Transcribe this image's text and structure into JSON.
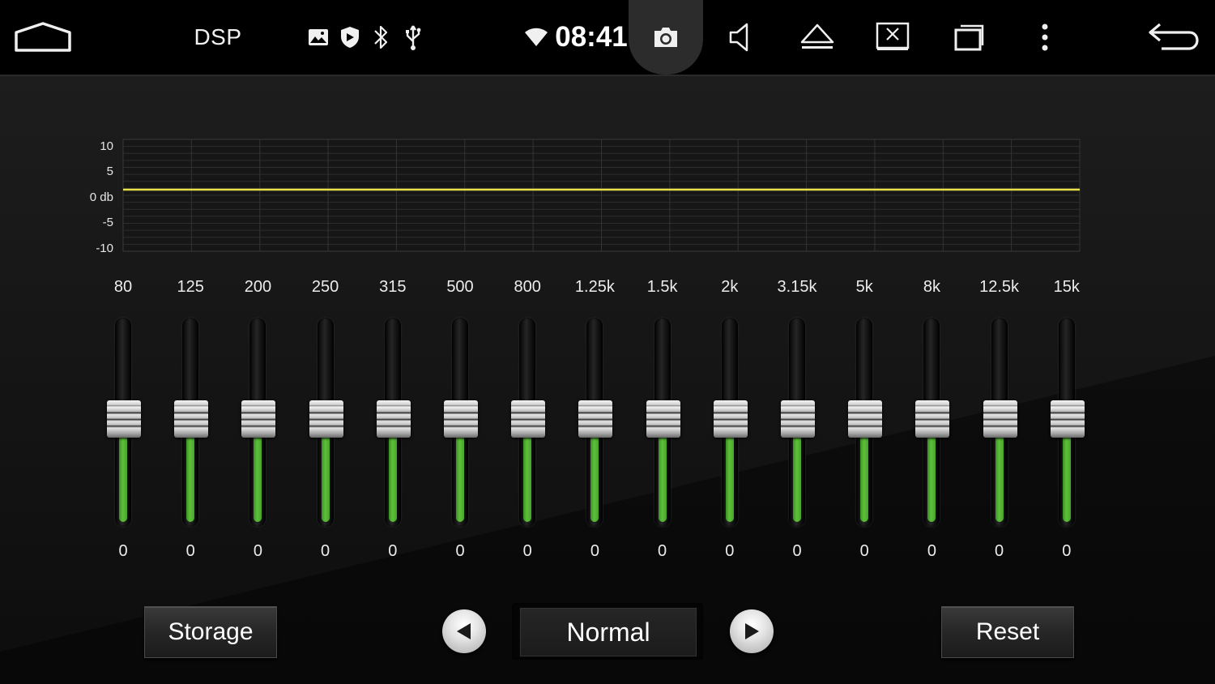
{
  "status_bar": {
    "app_title": "DSP",
    "clock": "08:41",
    "icons": {
      "home": "home-icon",
      "gallery": "image-icon",
      "shield": "shield-icon",
      "bluetooth": "bluetooth-icon",
      "usb": "usb-icon",
      "wifi": "wifi-icon",
      "screenshot": "camera-icon",
      "volume": "volume-icon",
      "eject": "eject-icon",
      "screen_off": "screen-off-icon",
      "recents": "recents-icon",
      "menu": "more-vert-icon",
      "back": "back-icon"
    }
  },
  "curve": {
    "y_labels": [
      "10",
      "5",
      "0 db",
      "-5",
      "-10"
    ],
    "line_color": "#e8e04a"
  },
  "bands": [
    {
      "freq": "80",
      "value": "0",
      "level": 0
    },
    {
      "freq": "125",
      "value": "0",
      "level": 0
    },
    {
      "freq": "200",
      "value": "0",
      "level": 0
    },
    {
      "freq": "250",
      "value": "0",
      "level": 0
    },
    {
      "freq": "315",
      "value": "0",
      "level": 0
    },
    {
      "freq": "500",
      "value": "0",
      "level": 0
    },
    {
      "freq": "800",
      "value": "0",
      "level": 0
    },
    {
      "freq": "1.25k",
      "value": "0",
      "level": 0
    },
    {
      "freq": "1.5k",
      "value": "0",
      "level": 0
    },
    {
      "freq": "2k",
      "value": "0",
      "level": 0
    },
    {
      "freq": "3.15k",
      "value": "0",
      "level": 0
    },
    {
      "freq": "5k",
      "value": "0",
      "level": 0
    },
    {
      "freq": "8k",
      "value": "0",
      "level": 0
    },
    {
      "freq": "12.5k",
      "value": "0",
      "level": 0
    },
    {
      "freq": "15k",
      "value": "0",
      "level": 0
    }
  ],
  "controls": {
    "storage_label": "Storage",
    "preset": "Normal",
    "reset_label": "Reset",
    "prev_icon": "triangle-left-icon",
    "next_icon": "triangle-right-icon"
  },
  "colors": {
    "fill_green": "#5cc23a",
    "curve_yellow": "#e8e04a"
  }
}
